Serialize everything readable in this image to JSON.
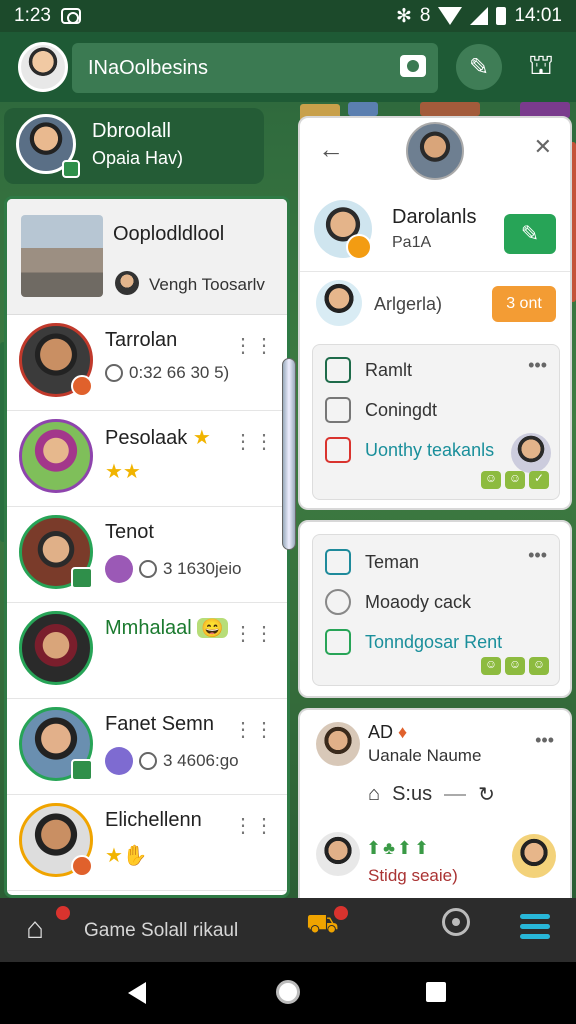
{
  "status_bar": {
    "time_left": "1:23",
    "time_right": "14:01"
  },
  "app_bar": {
    "search_text": "INaOolbesins"
  },
  "profile_card": {
    "name": "Dbroolall",
    "subtitle": "Opaia Hav)"
  },
  "left_panel": {
    "header": {
      "title": "Ooplodldlool",
      "subtitle": "Vengh Toosarlv"
    },
    "contacts": [
      {
        "name": "Tarrolan",
        "meta": "0:32 66 30 5)"
      },
      {
        "name": "Pesolaak",
        "meta": ""
      },
      {
        "name": "Tenot",
        "meta": "3 1630jeio"
      },
      {
        "name": "Mmhalaal",
        "meta": ""
      },
      {
        "name": "Fanet Semn",
        "meta": "3 4606:go"
      },
      {
        "name": "Elichellenn",
        "meta": ""
      }
    ]
  },
  "right_panel_1": {
    "row1": {
      "name": "Darolanls",
      "sub": "Pa1A"
    },
    "row2": {
      "name": "Arlgerla)",
      "button": "3 ont"
    },
    "subcard": {
      "item1": "Ramlt",
      "item2": "Coningdt",
      "item3": "Uonthy teakanls"
    }
  },
  "right_panel_2": {
    "item1": "Teman",
    "item2": "Moaody cack",
    "item3": "Tonndgosar Rent"
  },
  "right_panel_3": {
    "name": "AD",
    "subtitle": "Uanale Naume",
    "status": "S:us",
    "footer": "Stidg seaie)"
  },
  "bottom_nav": {
    "label": "Game Solall rikaul"
  }
}
